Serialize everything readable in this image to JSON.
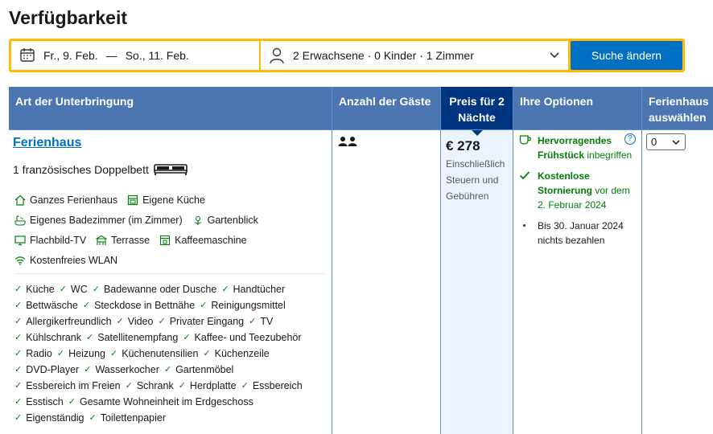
{
  "page_title": "Verfügbarkeit",
  "search": {
    "checkin": "Fr., 9. Feb.",
    "dash": "—",
    "checkout": "So., 11. Feb.",
    "guests": "2 Erwachsene · 0 Kinder · 1 Zimmer",
    "button_label": "Suche ändern"
  },
  "table": {
    "headers": {
      "type": "Art der Unterbringung",
      "guests": "Anzahl der Gäste",
      "price": "Preis für 2 Nächte",
      "options": "Ihre Optionen",
      "select": "Ferienhaus auswählen"
    },
    "row": {
      "name": "Ferienhaus",
      "bed": "1 französisches Doppelbett",
      "facilities": [
        [
          {
            "icon": "house-icon",
            "label": "Ganzes Ferienhaus"
          },
          {
            "icon": "kitchen-icon",
            "label": "Eigene Küche"
          }
        ],
        [
          {
            "icon": "bath-icon",
            "label": "Eigenes Badezimmer (im Zimmer)"
          },
          {
            "icon": "garden-icon",
            "label": "Gartenblick"
          }
        ],
        [
          {
            "icon": "tv-icon",
            "label": "Flachbild-TV"
          },
          {
            "icon": "terrace-icon",
            "label": "Terrasse"
          },
          {
            "icon": "coffee-machine-icon",
            "label": "Kaffeemaschine"
          }
        ],
        [
          {
            "icon": "wifi-icon",
            "label": "Kostenfreies WLAN"
          }
        ]
      ],
      "amenities": [
        [
          "Küche",
          "WC",
          "Badewanne oder Dusche",
          "Handtücher"
        ],
        [
          "Bettwäsche",
          "Steckdose in Bettnähe",
          "Reinigungsmittel"
        ],
        [
          "Allergikerfreundlich",
          "Video",
          "Privater Eingang",
          "TV"
        ],
        [
          "Kühlschrank",
          "Satellitenempfang",
          "Kaffee- und Teezubehör"
        ],
        [
          "Radio",
          "Heizung",
          "Küchenutensilien",
          "Küchenzeile"
        ],
        [
          "DVD-Player",
          "Wasserkocher",
          "Gartenmöbel"
        ],
        [
          "Essbereich im Freien",
          "Schrank",
          "Herdplatte",
          "Essbereich"
        ],
        [
          "Esstisch",
          "Gesamte Wohneinheit im Erdgeschoss"
        ],
        [
          "Eigenständig",
          "Toilettenpapier"
        ]
      ],
      "price": "€ 278",
      "price_note": "Einschließlich Steuern und Gebühren",
      "options": {
        "breakfast_bold": "Hervorragendes Frühstück",
        "breakfast_rest": "inbegriffen",
        "cancel_bold": "Kostenlose Stornierung",
        "cancel_rest": "vor dem 2. Februar 2024",
        "pay_note": "Bis 30. Januar 2024 nichts bezahlen",
        "help": "?"
      },
      "select_value": "0"
    }
  },
  "colors": {
    "header_bg": "#4c76b2",
    "header_highlight": "#003580",
    "accent_yellow": "#febb02",
    "button_blue": "#0071c2",
    "green": "#008009"
  }
}
